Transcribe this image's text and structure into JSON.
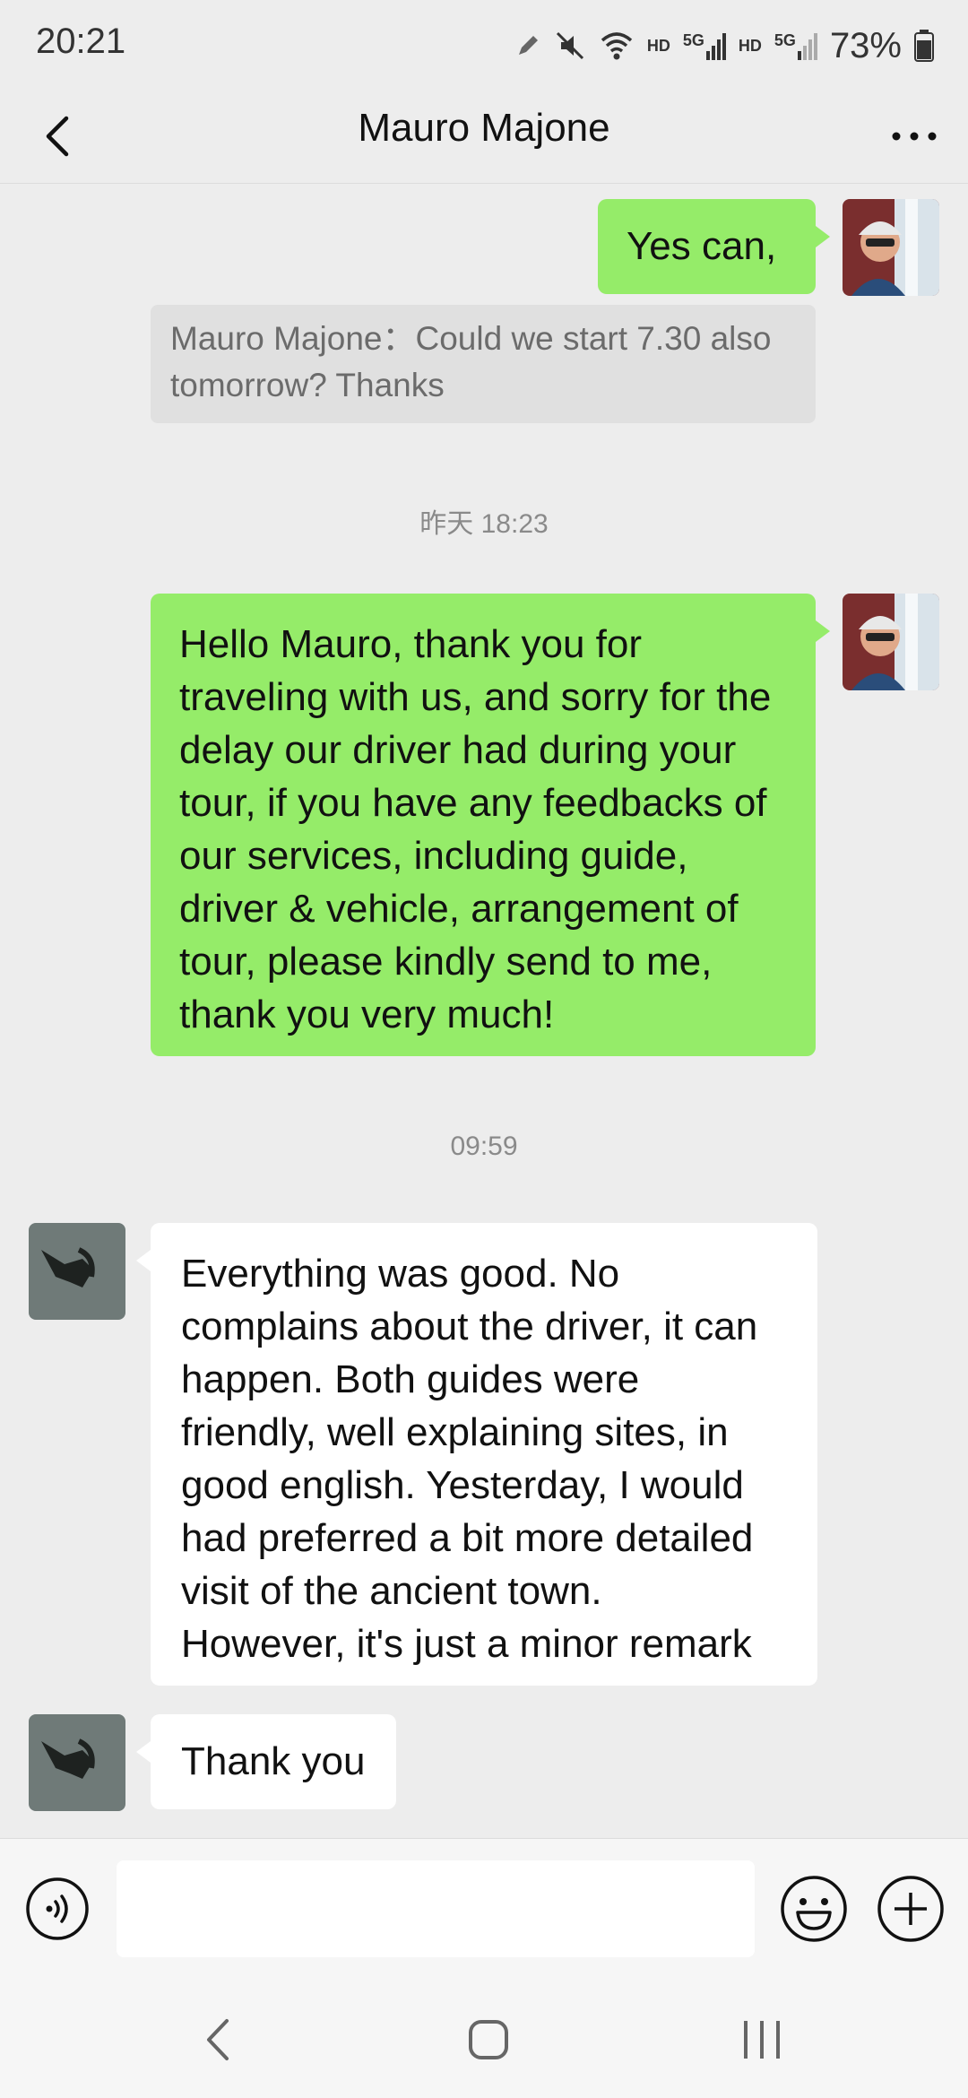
{
  "status_bar": {
    "time": "20:21",
    "hd1": "HD",
    "net1": "5G",
    "hd2": "HD",
    "net2": "5G",
    "battery": "73%"
  },
  "header": {
    "title": "Mauro Majone",
    "back_icon": "chevron-left-icon",
    "more_icon": "more-dots-icon"
  },
  "messages": {
    "m1": {
      "text": "Yes can,"
    },
    "quote": {
      "text": "Mauro Majone：Could we start 7.30 also tomorrow? Thanks"
    },
    "ts1": "昨天 18:23",
    "m2": {
      "lines": [
        "Hello Mauro, thank you for",
        "traveling with us, and sorry for the",
        "delay our driver had during your",
        "tour, if you have any feedbacks of",
        "our services, including guide,",
        "driver & vehicle, arrangement of",
        "tour, please kindly send to me,",
        "thank you very much!"
      ]
    },
    "ts2": "09:59",
    "m3": {
      "lines": [
        "Everything was good. No",
        "complains about  the driver, it can",
        "happen. Both guides were",
        "friendly, well explaining sites, in",
        "good english. Yesterday, I would",
        "had preferred a bit more detailed",
        "visit  of the ancient town.",
        "However, it's just a minor remark"
      ]
    },
    "m4": {
      "text": "Thank you"
    }
  },
  "input_bar": {
    "placeholder": "",
    "voice_icon": "voice-icon",
    "emoji_icon": "emoji-icon",
    "plus_icon": "plus-icon"
  },
  "colors": {
    "bubble_mine": "#95ec69",
    "bubble_other": "#ffffff",
    "background": "#ededed"
  }
}
